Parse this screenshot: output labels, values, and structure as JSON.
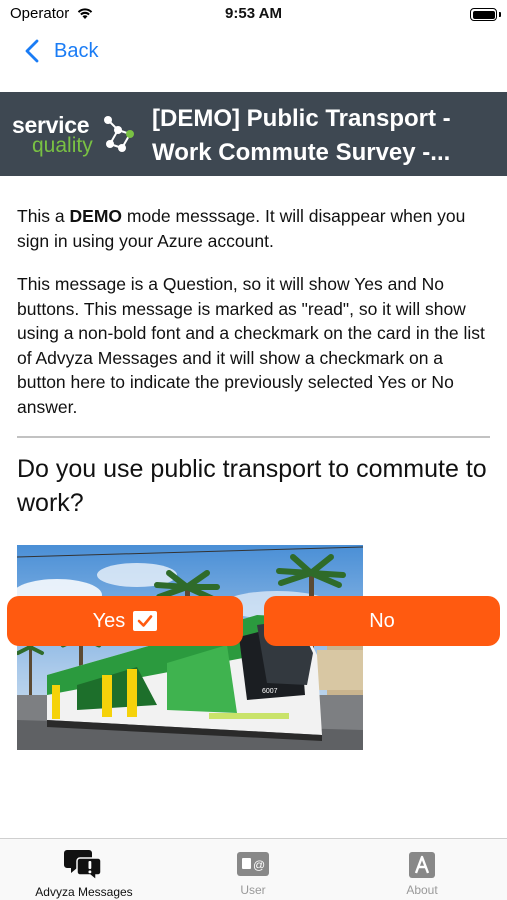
{
  "status_bar": {
    "carrier": "Operator",
    "time": "9:53 AM"
  },
  "nav": {
    "back_label": "Back"
  },
  "header": {
    "logo_line1": "service",
    "logo_line2": "quality",
    "title_line1": "[DEMO] Public Transport -",
    "title_line2": "Work Commute Survey -..."
  },
  "message": {
    "para1_prefix": "This a ",
    "para1_bold": "DEMO",
    "para1_suffix": " mode messsage. It will disappear when you sign in using your Azure account.",
    "para2": "This message is a Question, so it will show Yes and No buttons. This message is marked as \"read\", so it will show using a non-bold font and a checkmark on the card in the list of Advyza Messages and it will show a checkmark on a button here to indicate the previously selected Yes or No answer.",
    "question": "Do you use public transport to commute to work?",
    "image_label": "tram photo",
    "tram_number": "6007"
  },
  "answers": {
    "yes_label": "Yes",
    "no_label": "No",
    "selected": "Yes"
  },
  "tab_bar": {
    "tabs": [
      {
        "label": "Advyza Messages",
        "icon": "chat-alert-icon",
        "active": true
      },
      {
        "label": "User",
        "icon": "user-card-icon",
        "active": false
      },
      {
        "label": "About",
        "icon": "about-a-icon",
        "active": false
      }
    ]
  },
  "colors": {
    "accent_blue": "#1a7cf5",
    "header_bg": "#3e4852",
    "button_orange": "#ff5a10",
    "logo_green": "#79c143"
  }
}
